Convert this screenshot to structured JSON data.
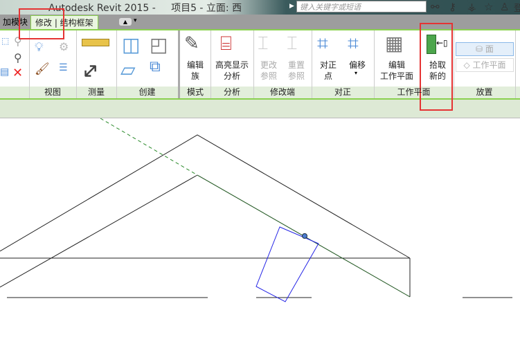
{
  "titlebar": {
    "title": "Autodesk Revit 2015 -     项目5 - 立面: 西",
    "search_placeholder": "键入关键字或短语",
    "icons": [
      "binoculars-icon",
      "key-icon",
      "satellite-icon",
      "star-icon",
      "user-icon"
    ],
    "signin_partial": "登"
  },
  "tabs": {
    "prev_partial": "加模块",
    "active": "修改 | 结构框架"
  },
  "panels": [
    {
      "label": "视图"
    },
    {
      "label": "测量"
    },
    {
      "label": "创建"
    },
    {
      "label": "模式",
      "buttons": [
        {
          "label": "编辑\n族"
        }
      ]
    },
    {
      "label": "分析",
      "buttons": [
        {
          "label": "高亮显示\n分析"
        }
      ]
    },
    {
      "label": "修改端",
      "buttons": [
        {
          "label": "更改\n参照",
          "disabled": true
        },
        {
          "label": "重置\n参照",
          "disabled": true
        }
      ]
    },
    {
      "label": "对正",
      "buttons": [
        {
          "label": "对正\n点"
        },
        {
          "label": "偏移"
        }
      ]
    },
    {
      "label": "工作平面",
      "buttons": [
        {
          "label": "编辑\n工作平面"
        },
        {
          "label": "拾取\n新的"
        }
      ]
    },
    {
      "label": "放置",
      "buttons": [
        {
          "label": "面",
          "disabled": true
        },
        {
          "label": "工作平面",
          "disabled": true
        }
      ]
    }
  ],
  "colors": {
    "accent_green": "#8ad04f",
    "highlight_red": "#e53333",
    "selection_blue": "#2323e6",
    "workplane_green": "#2a8a2a"
  }
}
